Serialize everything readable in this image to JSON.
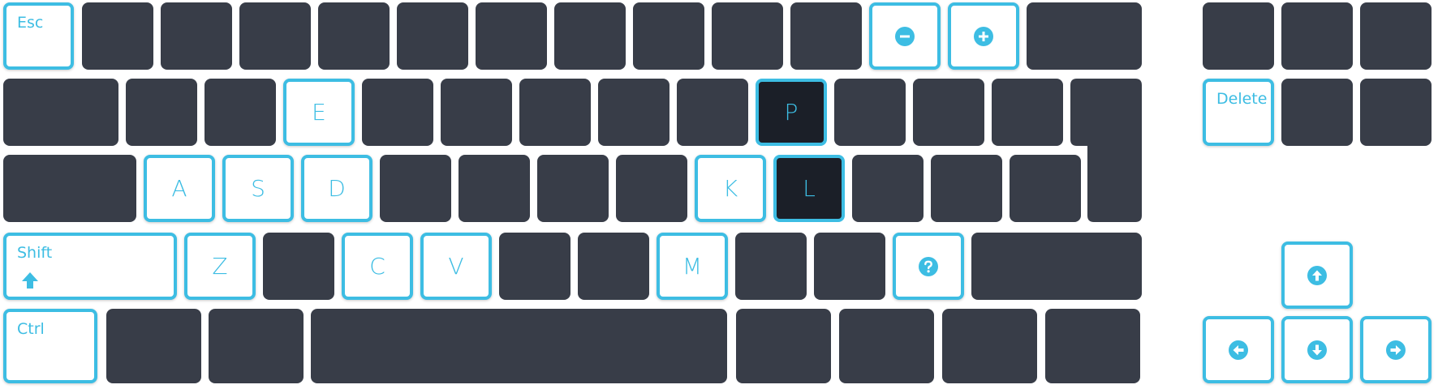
{
  "colors": {
    "key_dark": "#383d48",
    "key_darker": "#1b1f28",
    "key_highlight_bg": "#ffffff",
    "accent": "#3dbde3"
  },
  "keys": {
    "esc": "Esc",
    "minus": "minus-circle-icon",
    "plus": "plus-circle-icon",
    "delete": "Delete",
    "e": "E",
    "p": "P",
    "a": "A",
    "s": "S",
    "d": "D",
    "k": "K",
    "l": "L",
    "shift": "Shift",
    "z": "Z",
    "c": "C",
    "v": "V",
    "m": "M",
    "question": "question-circle-icon",
    "ctrl": "Ctrl",
    "arrow_up": "arrow-up-circle-icon",
    "arrow_left": "arrow-left-circle-icon",
    "arrow_down": "arrow-down-circle-icon",
    "arrow_right": "arrow-right-circle-icon"
  }
}
